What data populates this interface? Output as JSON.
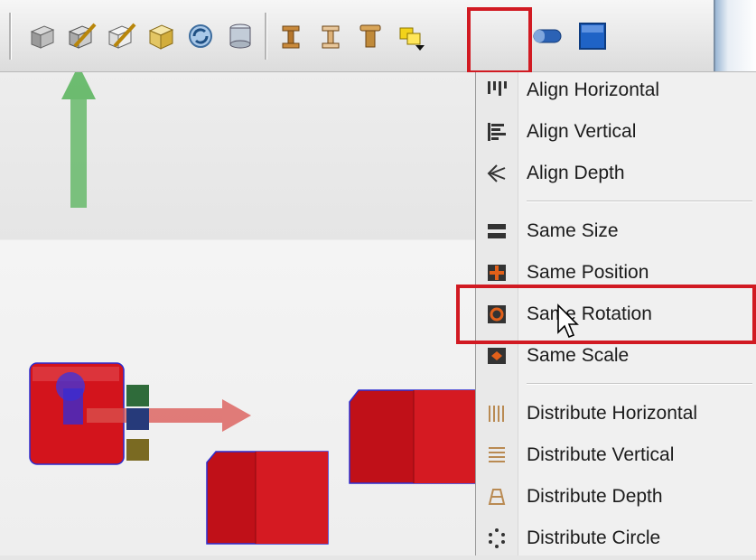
{
  "toolbar": {
    "buttons": [
      {
        "icon": "cube-shaded-icon"
      },
      {
        "icon": "edit-cube-icon"
      },
      {
        "icon": "edit-cube-outline-icon"
      },
      {
        "icon": "cube-yellow-icon"
      },
      {
        "icon": "refresh-icon"
      },
      {
        "icon": "cylinder-icon"
      },
      {
        "icon": "beam-icon"
      },
      {
        "icon": "beam-outline-icon"
      },
      {
        "icon": "pillar-icon"
      },
      {
        "icon": "align-dropdown-icon"
      },
      {
        "icon": "pipe-icon"
      },
      {
        "icon": "blue-panel-icon"
      }
    ]
  },
  "menu": {
    "items": [
      {
        "label": "Align Horizontal",
        "icon": "align-horizontal-icon"
      },
      {
        "label": "Align Vertical",
        "icon": "align-vertical-icon"
      },
      {
        "label": "Align Depth",
        "icon": "align-depth-icon"
      },
      {
        "label": "Same Size",
        "icon": "same-size-icon"
      },
      {
        "label": "Same Position",
        "icon": "same-position-icon"
      },
      {
        "label": "Same Rotation",
        "icon": "same-rotation-icon"
      },
      {
        "label": "Same Scale",
        "icon": "same-scale-icon"
      },
      {
        "label": "Distribute Horizontal",
        "icon": "distribute-horizontal-icon"
      },
      {
        "label": "Distribute Vertical",
        "icon": "distribute-vertical-icon"
      },
      {
        "label": "Distribute Depth",
        "icon": "distribute-depth-icon"
      },
      {
        "label": "Distribute Circle",
        "icon": "distribute-circle-icon"
      }
    ]
  },
  "colors": {
    "highlight": "#d11a22",
    "cube_red": "#d3141c",
    "gizmo_green": "#4caf50",
    "gizmo_red": "#d9534f"
  }
}
